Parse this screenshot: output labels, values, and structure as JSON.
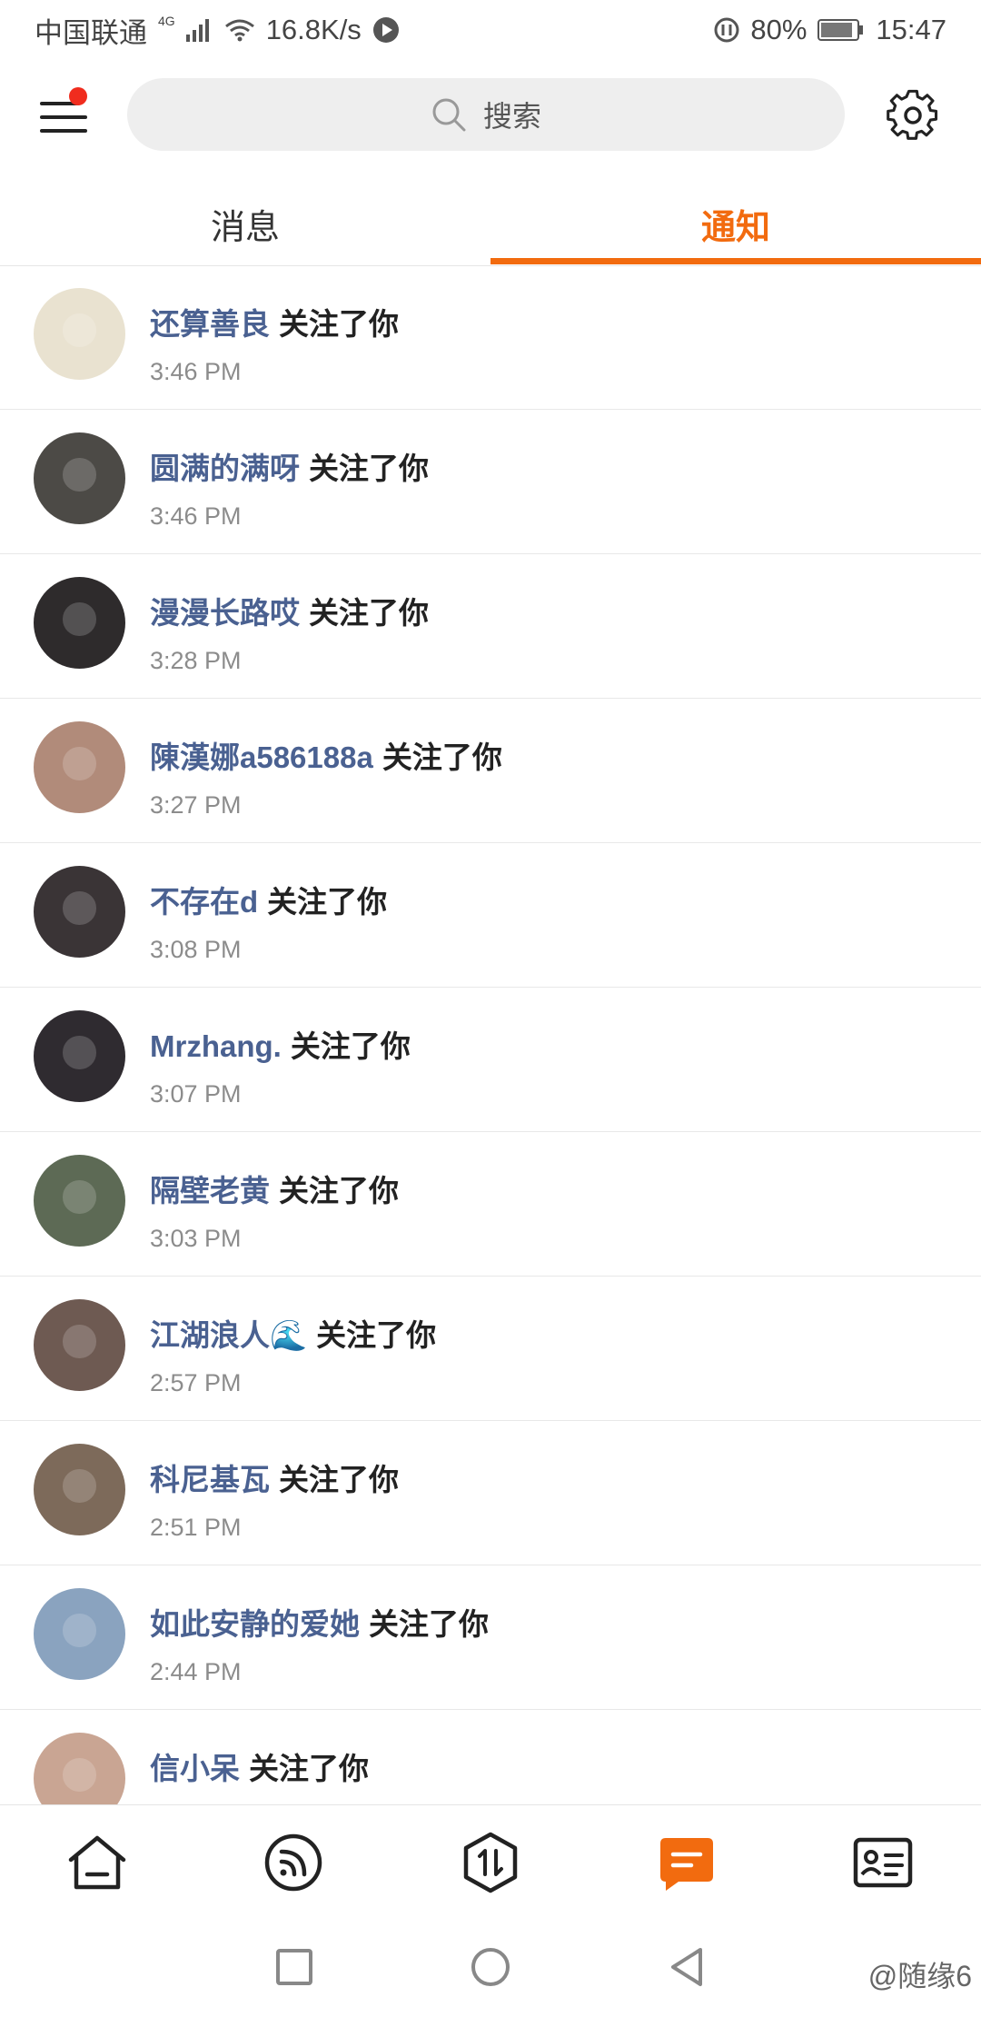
{
  "status_bar": {
    "carrier": "中国联通",
    "network": "4G",
    "speed": "16.8K/s",
    "battery": "80%",
    "time": "15:47"
  },
  "header": {
    "search_placeholder": "搜索"
  },
  "tabs": [
    {
      "label": "消息",
      "active": false
    },
    {
      "label": "通知",
      "active": true
    }
  ],
  "colors": {
    "accent": "#f26b0f",
    "username": "#4a6191",
    "badge": "#f02c1e"
  },
  "notifications": [
    {
      "user": "还算善良",
      "action": "关注了你",
      "time": "3:46 PM",
      "avatar_color": "#e9e2d0"
    },
    {
      "user": "圆满的满呀",
      "action": "关注了你",
      "time": "3:46 PM",
      "avatar_color": "#4c4a46"
    },
    {
      "user": "漫漫长路哎",
      "action": "关注了你",
      "time": "3:28 PM",
      "avatar_color": "#2e2b2c"
    },
    {
      "user": "陳漢娜a586188a",
      "action": "关注了你",
      "time": "3:27 PM",
      "avatar_color": "#b18b7a"
    },
    {
      "user": "不存在d",
      "action": "关注了你",
      "time": "3:08 PM",
      "avatar_color": "#3a3436"
    },
    {
      "user": "Mrzhang.",
      "action": "关注了你",
      "time": "3:07 PM",
      "avatar_color": "#2f2b30"
    },
    {
      "user": "隔壁老黄",
      "action": "关注了你",
      "time": "3:03 PM",
      "avatar_color": "#5d6a55"
    },
    {
      "user": "江湖浪人🌊",
      "action": "关注了你",
      "time": "2:57 PM",
      "avatar_color": "#6e5a52"
    },
    {
      "user": "科尼基瓦",
      "action": "关注了你",
      "time": "2:51 PM",
      "avatar_color": "#7d6a5a"
    },
    {
      "user": "如此安静的爱她",
      "action": "关注了你",
      "time": "2:44 PM",
      "avatar_color": "#8aa3bf"
    },
    {
      "user": "信小呆",
      "action": "关注了你",
      "time": "",
      "avatar_color": "#c9a593"
    }
  ],
  "bottom_nav": [
    {
      "icon": "home-icon",
      "active": false
    },
    {
      "icon": "feed-icon",
      "active": false
    },
    {
      "icon": "exchange-icon",
      "active": false
    },
    {
      "icon": "message-icon",
      "active": true
    },
    {
      "icon": "contact-card-icon",
      "active": false
    }
  ],
  "watermark": "@随缘6"
}
